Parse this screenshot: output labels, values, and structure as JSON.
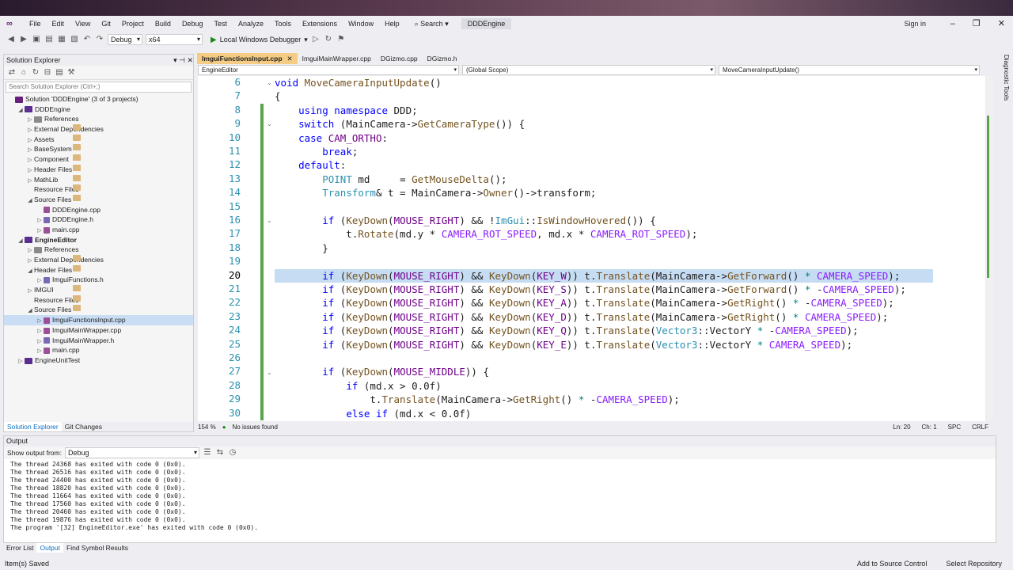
{
  "app": {
    "solution_name": "DDDEngine",
    "sign_in": "Sign in",
    "search": "Search"
  },
  "menu": [
    "File",
    "Edit",
    "View",
    "Git",
    "Project",
    "Build",
    "Debug",
    "Test",
    "Analyze",
    "Tools",
    "Extensions",
    "Window",
    "Help"
  ],
  "toolbar": {
    "config": "Debug",
    "platform": "x64",
    "debugger": "Local Windows Debugger"
  },
  "solution_explorer": {
    "title": "Solution Explorer",
    "search_placeholder": "Search Solution Explorer (Ctrl+;)",
    "items": [
      {
        "label": "Solution 'DDDEngine' (3 of 3 projects)",
        "depth": 0,
        "icon": "sol",
        "arrow": ""
      },
      {
        "label": "DDDEngine",
        "depth": 1,
        "icon": "proj",
        "arrow": "◢"
      },
      {
        "label": "References",
        "depth": 2,
        "icon": "ref",
        "arrow": "▷"
      },
      {
        "label": "External Dependencies",
        "depth": 2,
        "icon": "fold",
        "arrow": "▷"
      },
      {
        "label": "Assets",
        "depth": 2,
        "icon": "fold",
        "arrow": "▷"
      },
      {
        "label": "BaseSystem",
        "depth": 2,
        "icon": "fold",
        "arrow": "▷"
      },
      {
        "label": "Component",
        "depth": 2,
        "icon": "fold",
        "arrow": "▷"
      },
      {
        "label": "Header Files",
        "depth": 2,
        "icon": "fold",
        "arrow": "▷"
      },
      {
        "label": "MathLib",
        "depth": 2,
        "icon": "fold",
        "arrow": "▷"
      },
      {
        "label": "Resource Files",
        "depth": 2,
        "icon": "fold",
        "arrow": ""
      },
      {
        "label": "Source Files",
        "depth": 2,
        "icon": "fold",
        "arrow": "◢"
      },
      {
        "label": "DDDEngine.cpp",
        "depth": 3,
        "icon": "cpp",
        "arrow": ""
      },
      {
        "label": "DDDEngine.h",
        "depth": 3,
        "icon": "h",
        "arrow": "▷"
      },
      {
        "label": "main.cpp",
        "depth": 3,
        "icon": "cpp",
        "arrow": "▷"
      },
      {
        "label": "EngineEditor",
        "depth": 1,
        "icon": "proj",
        "arrow": "◢",
        "bold": true
      },
      {
        "label": "References",
        "depth": 2,
        "icon": "ref",
        "arrow": "▷"
      },
      {
        "label": "External Dependencies",
        "depth": 2,
        "icon": "fold",
        "arrow": "▷"
      },
      {
        "label": "Header Files",
        "depth": 2,
        "icon": "fold",
        "arrow": "◢"
      },
      {
        "label": "ImguiFunctions.h",
        "depth": 3,
        "icon": "h",
        "arrow": "▷"
      },
      {
        "label": "IMGUI",
        "depth": 2,
        "icon": "fold",
        "arrow": "▷"
      },
      {
        "label": "Resource Files",
        "depth": 2,
        "icon": "fold",
        "arrow": ""
      },
      {
        "label": "Source Files",
        "depth": 2,
        "icon": "fold",
        "arrow": "◢"
      },
      {
        "label": "ImguiFunctionsInput.cpp",
        "depth": 3,
        "icon": "cpp",
        "arrow": "▷",
        "sel": true
      },
      {
        "label": "ImguiMainWrapper.cpp",
        "depth": 3,
        "icon": "cpp",
        "arrow": "▷"
      },
      {
        "label": "ImguiMainWrapper.h",
        "depth": 3,
        "icon": "h",
        "arrow": "▷"
      },
      {
        "label": "main.cpp",
        "depth": 3,
        "icon": "cpp",
        "arrow": "▷"
      },
      {
        "label": "EngineUnitTest",
        "depth": 1,
        "icon": "proj",
        "arrow": "▷"
      }
    ],
    "tabs": [
      "Solution Explorer",
      "Git Changes"
    ]
  },
  "editor": {
    "tabs": [
      "ImguiFunctionsInput.cpp",
      "ImguiMainWrapper.cpp",
      "DGizmo.cpp",
      "DGizmo.h"
    ],
    "nav": [
      "EngineEditor",
      "(Global Scope)",
      "MoveCameraInputUpdate()"
    ],
    "zoom": "154 %",
    "issues": "No issues found",
    "ln": "Ln: 20",
    "ch": "Ch: 1",
    "spc": "SPC",
    "crlf": "CRLF",
    "line_numbers": [
      "6",
      "7",
      "8",
      "9",
      "10",
      "11",
      "12",
      "13",
      "14",
      "15",
      "16",
      "17",
      "18",
      "19",
      "20",
      "21",
      "22",
      "23",
      "24",
      "25",
      "26",
      "27",
      "28",
      "29",
      "30"
    ],
    "current_line": "20"
  },
  "output": {
    "title": "Output",
    "show_from": "Show output from:",
    "source": "Debug",
    "lines": [
      "The thread 24368 has exited with code 0 (0x0).",
      "The thread 26516 has exited with code 0 (0x0).",
      "The thread 24400 has exited with code 0 (0x0).",
      "The thread 18820 has exited with code 0 (0x0).",
      "The thread 11664 has exited with code 0 (0x0).",
      "The thread 17560 has exited with code 0 (0x0).",
      "The thread 20460 has exited with code 0 (0x0).",
      "The thread 19876 has exited with code 0 (0x0).",
      "The program '[32] EngineEditor.exe' has exited with code 0 (0x0)."
    ],
    "tabs": [
      "Error List",
      "Output",
      "Find Symbol Results"
    ]
  },
  "status": {
    "left": "Item(s) Saved",
    "source_control": "Add to Source Control",
    "repo": "Select Repository"
  },
  "side": {
    "diag": "Diagnostic Tools"
  }
}
